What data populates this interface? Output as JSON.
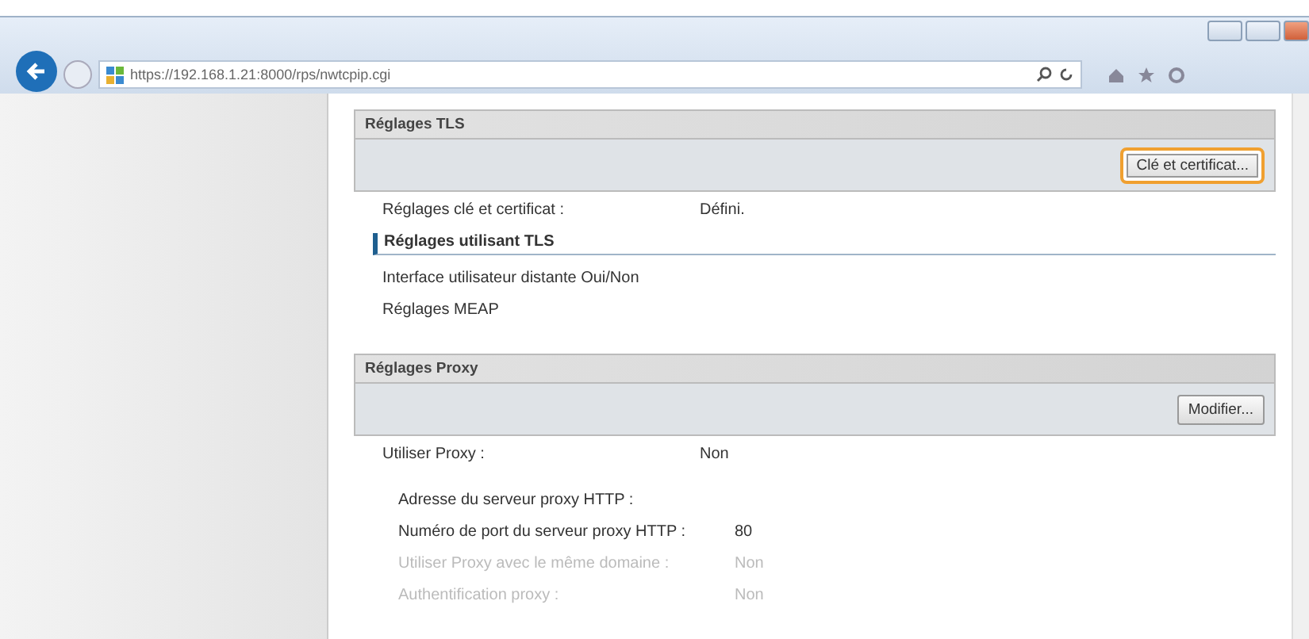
{
  "browser": {
    "url": "https://192.168.1.21:8000/rps/nwtcpip.cgi"
  },
  "sections": [
    {
      "title": "Réglages TLS",
      "button": {
        "label": "Clé et certificat...",
        "highlighted": true
      },
      "rows": [
        {
          "kind": "field",
          "label": "Réglages clé et certificat :",
          "value": "Défini."
        },
        {
          "kind": "heading",
          "label": "Réglages utilisant TLS"
        },
        {
          "kind": "link",
          "label": "Interface utilisateur distante Oui/Non"
        },
        {
          "kind": "link",
          "label": "Réglages MEAP"
        }
      ]
    },
    {
      "title": "Réglages Proxy",
      "button": {
        "label": "Modifier...",
        "highlighted": false
      },
      "rows": [
        {
          "kind": "field",
          "label": "Utiliser Proxy :",
          "value": "Non",
          "disabled": false,
          "children": [
            {
              "label": "Adresse du serveur proxy HTTP :",
              "disabled": false
            },
            {
              "label": "Numéro de port du serveur proxy HTTP :",
              "value": "80",
              "disabled": false
            },
            {
              "label": "Utiliser Proxy avec le même domaine :",
              "value": "Non",
              "disabled": true
            },
            {
              "label": "Authentification proxy :",
              "value": "Non",
              "disabled": true
            }
          ]
        }
      ]
    }
  ]
}
